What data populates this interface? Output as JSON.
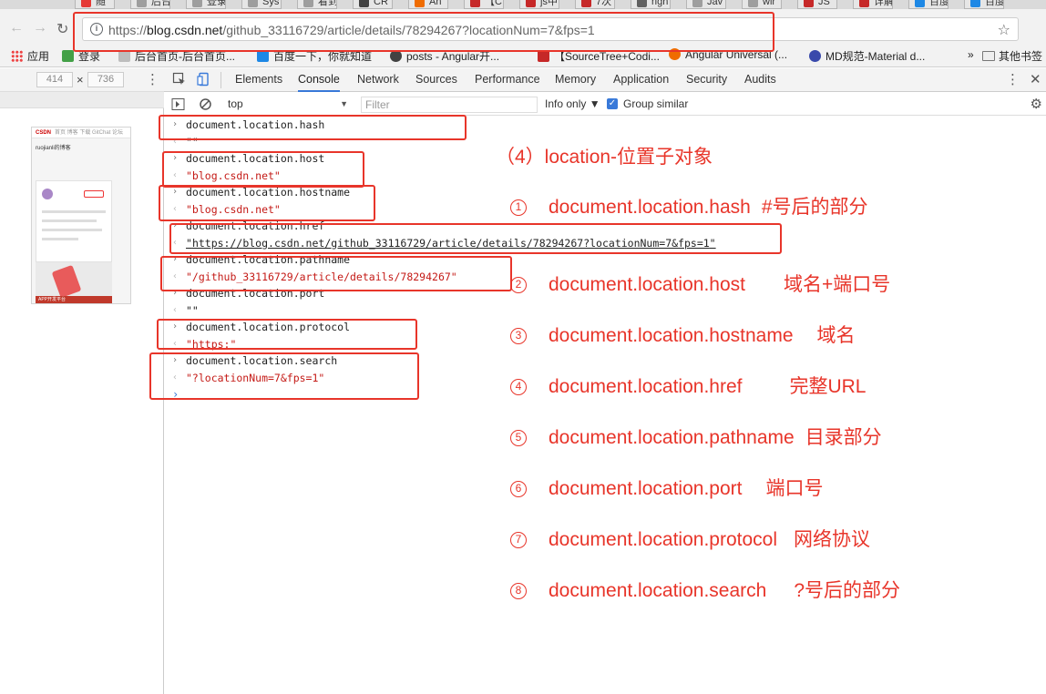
{
  "tabs": [
    {
      "label": "随",
      "color": "#e53935"
    },
    {
      "label": "后台",
      "color": "#9e9e9e"
    },
    {
      "label": "登录",
      "color": "#9e9e9e"
    },
    {
      "label": "Sys",
      "color": "#9e9e9e"
    },
    {
      "label": "看到",
      "color": "#9e9e9e"
    },
    {
      "label": "CR",
      "color": "#424242"
    },
    {
      "label": "An",
      "color": "#ef6c00"
    },
    {
      "label": "【C",
      "color": "#c62828"
    },
    {
      "label": "js中",
      "color": "#c62828"
    },
    {
      "label": "7次",
      "color": "#c62828"
    },
    {
      "label": "righ",
      "color": "#616161"
    },
    {
      "label": "Jav",
      "color": "#9e9e9e"
    },
    {
      "label": "wir",
      "color": "#9e9e9e"
    },
    {
      "label": "JS",
      "color": "#c62828"
    },
    {
      "label": "详解",
      "color": "#c62828"
    },
    {
      "label": "百度",
      "color": "#1e88e5"
    },
    {
      "label": "百度",
      "color": "#1e88e5"
    }
  ],
  "address": {
    "url_domain": "blog.csdn.net",
    "url_prefix": "https://",
    "url_path": "/github_33116729/article/details/78294267?locationNum=7&fps=1"
  },
  "bookmarks": [
    {
      "label": "应用",
      "icon": "apps-grid-icon",
      "color": "#e53935"
    },
    {
      "label": "登录",
      "icon": "h-logo-icon",
      "color": "#43a047"
    },
    {
      "label": "后台首页-后台首页...",
      "icon": "page-icon",
      "color": "#bdbdbd"
    },
    {
      "label": "百度一下，你就知道",
      "icon": "baidu-icon",
      "color": "#1e88e5"
    },
    {
      "label": "posts - Angular开...",
      "icon": "gear-icon",
      "color": "#424242"
    },
    {
      "label": "【SourceTree+Codi...",
      "icon": "csdn-icon",
      "color": "#c62828"
    },
    {
      "label": "Angular Universal (...",
      "icon": "reddit-icon",
      "color": "#ef6c00"
    },
    {
      "label": "MD规范-Material d...",
      "icon": "ui-icon",
      "color": "#3949ab"
    }
  ],
  "bookmarks_more": "»",
  "bookmarks_other": "其他书签",
  "device": {
    "width": "414",
    "height": "736",
    "times": "×"
  },
  "phone": {
    "logo": "CSDN",
    "nav": "首页 博客 下载 GitChat 论坛",
    "blog_title": "ruojianli的博客",
    "promo": "APP开发平台"
  },
  "devtools": {
    "tabs": [
      "Elements",
      "Console",
      "Network",
      "Sources",
      "Performance",
      "Memory",
      "Application",
      "Security",
      "Audits"
    ],
    "active_tab": "Console",
    "context": "top",
    "filter_placeholder": "Filter",
    "levels": "Info only ▼",
    "group_similar": "Group similar"
  },
  "console": [
    {
      "type": "in",
      "text": "document.location.hash"
    },
    {
      "type": "out",
      "text": "\"\"",
      "style": "plain"
    },
    {
      "type": "in",
      "text": "document.location.host"
    },
    {
      "type": "out",
      "text": "\"blog.csdn.net\"",
      "style": "string"
    },
    {
      "type": "in",
      "text": "document.location.hostname"
    },
    {
      "type": "out",
      "text": "\"blog.csdn.net\"",
      "style": "string"
    },
    {
      "type": "in",
      "text": "document.location.href"
    },
    {
      "type": "out",
      "text": "https://blog.csdn.net/github_33116729/article/details/78294267?locationNum=7&fps=1",
      "style": "link"
    },
    {
      "type": "in",
      "text": "document.location.pathname"
    },
    {
      "type": "out",
      "text": "\"/github_33116729/article/details/78294267\"",
      "style": "string"
    },
    {
      "type": "in",
      "text": "document.location.port"
    },
    {
      "type": "out",
      "text": "\"\"",
      "style": "plain"
    },
    {
      "type": "in",
      "text": "document.location.protocol"
    },
    {
      "type": "out",
      "text": "\"https:\"",
      "style": "string"
    },
    {
      "type": "in",
      "text": "document.location.search"
    },
    {
      "type": "out",
      "text": "\"?locationNum=7&fps=1\"",
      "style": "string"
    }
  ],
  "annotations": {
    "heading": "（4）location-位置子对象",
    "items": [
      {
        "num": "①",
        "prop": "document.location.hash",
        "desc": "#号后的部分"
      },
      {
        "num": "②",
        "prop": "document.location.host",
        "desc": "域名+端口号"
      },
      {
        "num": "③",
        "prop": "document.location.hostname",
        "desc": "域名"
      },
      {
        "num": "④",
        "prop": "document.location.href",
        "desc": "完整URL"
      },
      {
        "num": "⑤",
        "prop": "document.location.pathname",
        "desc": "目录部分"
      },
      {
        "num": "⑥",
        "prop": "document.location.port",
        "desc": "端口号"
      },
      {
        "num": "⑦",
        "prop": "document.location.protocol",
        "desc": "网络协议"
      },
      {
        "num": "⑧",
        "prop": "document.location.search",
        "desc": "?号后的部分"
      }
    ],
    "color": "#e8352a"
  }
}
